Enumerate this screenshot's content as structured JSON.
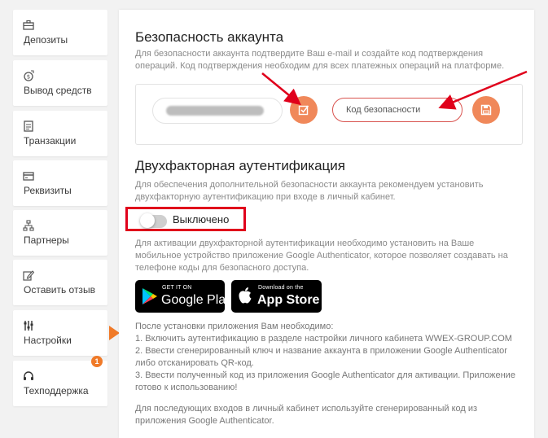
{
  "sidebar": {
    "items": [
      {
        "label": "Депозиты",
        "icon": "briefcase-icon"
      },
      {
        "label": "Вывод средств",
        "icon": "coin-withdraw-icon"
      },
      {
        "label": "Транзакции",
        "icon": "document-icon"
      },
      {
        "label": "Реквизиты",
        "icon": "card-icon"
      },
      {
        "label": "Партнеры",
        "icon": "network-icon"
      },
      {
        "label": "Оставить отзыв",
        "icon": "pencil-icon"
      },
      {
        "label": "Настройки",
        "icon": "sliders-icon",
        "active": true
      },
      {
        "label": "Техподдержка",
        "icon": "headset-icon",
        "badge": "1"
      }
    ]
  },
  "security": {
    "title": "Безопасность аккаунта",
    "description": "Для безопасности аккаунта подтвердите Ваш e-mail и создайте код подтверждения операций. Код подтверждения необходим для всех платежных операций на платформе.",
    "code_placeholder": "Код безопасности"
  },
  "two_factor": {
    "title": "Двухфакторная аутентификация",
    "description": "Для обеспечения дополнительной безопасности аккаунта рекомендуем установить двухфакторную аутентификацию при входе в личный кабинет.",
    "toggle_label": "Выключено",
    "toggle_on": false,
    "install_text": "Для активации двухфакторной аутентификации необходимо установить на Ваше мобильное устройство приложение Google Authenticator, которое позволяет создавать на телефоне коды для безопасного доступа.",
    "google_play_small": "GET IT ON",
    "google_play_big": "Google Play",
    "app_store_small": "Download on the",
    "app_store_big": "App Store",
    "steps": [
      "После установки приложения Вам необходимо:",
      "1. Включить аутентификацию в разделе настройки личного кабинета WWEX-GROUP.COM",
      "2. Ввести сгенерированный ключ и название аккаунта в приложении Google Authenticator либо отсканировать QR-код.",
      "3. Ввести полученный код из приложения Google Authenticator для активации. Приложение готово к использованию!"
    ],
    "footer_text": "Для последующих входов в личный кабинет используйте сгенерированный код из приложения Google Authenticator."
  },
  "colors": {
    "accent": "#f07a28",
    "button": "#f0885a",
    "highlight": "#e0001b"
  }
}
